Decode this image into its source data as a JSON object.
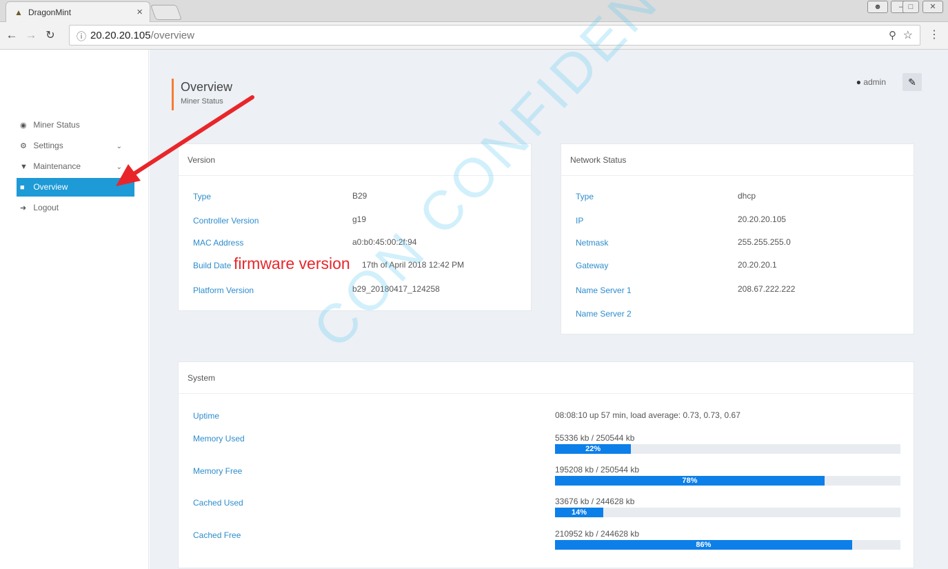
{
  "browser": {
    "tab_title": "DragonMint",
    "tab_close": "×",
    "url_host": "20.20.20.105",
    "url_path": "/overview"
  },
  "sidebar": {
    "items": [
      {
        "label": "Miner Status",
        "icon": "dashboard-icon"
      },
      {
        "label": "Settings",
        "icon": "cogs-icon"
      },
      {
        "label": "Maintenance",
        "icon": "plug-icon"
      },
      {
        "label": "Overview",
        "icon": "chip-icon"
      },
      {
        "label": "Logout",
        "icon": "sign-out-icon"
      }
    ]
  },
  "header": {
    "title": "Overview",
    "subtitle": "Miner Status",
    "user": "admin"
  },
  "version": {
    "title": "Version",
    "rows": [
      {
        "label": "Type",
        "value": "B29"
      },
      {
        "label": "Controller Version",
        "value": "g19"
      },
      {
        "label": "MAC Address",
        "value": "a0:b0:45:00:2f:94"
      },
      {
        "label": "Build Date",
        "value": "17th of April 2018 12:42 PM"
      },
      {
        "label": "Platform Version",
        "value": "b29_20180417_124258"
      }
    ]
  },
  "network": {
    "title": "Network Status",
    "rows": [
      {
        "label": "Type",
        "value": "dhcp"
      },
      {
        "label": "IP",
        "value": "20.20.20.105"
      },
      {
        "label": "Netmask",
        "value": "255.255.255.0"
      },
      {
        "label": "Gateway",
        "value": "20.20.20.1"
      },
      {
        "label": "Name Server 1",
        "value": "208.67.222.222"
      },
      {
        "label": "Name Server 2",
        "value": ""
      }
    ]
  },
  "system": {
    "title": "System",
    "uptime_label": "Uptime",
    "uptime_value": "08:08:10 up 57 min, load average: 0.73, 0.73, 0.67",
    "rows": [
      {
        "label": "Memory Used",
        "value": "55336 kb / 250544 kb",
        "percent": 22,
        "percent_label": "22%"
      },
      {
        "label": "Memory Free",
        "value": "195208 kb / 250544 kb",
        "percent": 78,
        "percent_label": "78%"
      },
      {
        "label": "Cached Used",
        "value": "33676 kb / 244628 kb",
        "percent": 14,
        "percent_label": "14%"
      },
      {
        "label": "Cached Free",
        "value": "210952 kb / 244628 kb",
        "percent": 86,
        "percent_label": "86%"
      }
    ]
  },
  "annotation": {
    "text": "firmware version",
    "color": "#e8262a"
  },
  "watermark": {
    "text": "CON CONFIDENTIAL"
  },
  "colors": {
    "accent": "#1e9ad6",
    "progress": "#0d7fe8",
    "title_bar": "#f57c33",
    "label": "#2d8ccc"
  }
}
